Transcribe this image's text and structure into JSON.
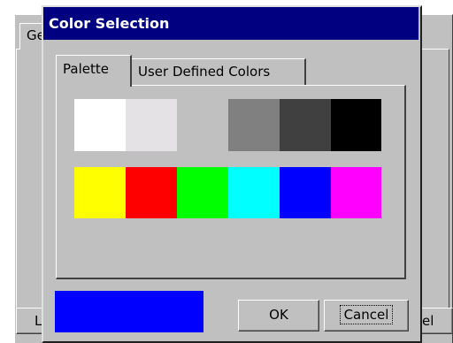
{
  "background_window": {
    "tab_label": "Ge",
    "left_button_label": "L",
    "right_button_label": "el"
  },
  "dialog": {
    "title": "Color Selection",
    "tabs": [
      {
        "label": "Palette",
        "selected": true
      },
      {
        "label": "User Defined Colors",
        "selected": false
      }
    ],
    "palette": {
      "row1": [
        "#ffffff",
        "#e5e2e5",
        null,
        "#808080",
        "#404040",
        "#000000"
      ],
      "row2": [
        "#ffff00",
        "#ff0000",
        "#00ff00",
        "#00ffff",
        "#0000ff",
        "#ff00ff"
      ]
    },
    "selected_color": "#0000ff",
    "buttons": {
      "ok": "OK",
      "cancel": "Cancel"
    }
  },
  "colors": {
    "titlebar": "#000080",
    "face": "#c0c0c0"
  }
}
